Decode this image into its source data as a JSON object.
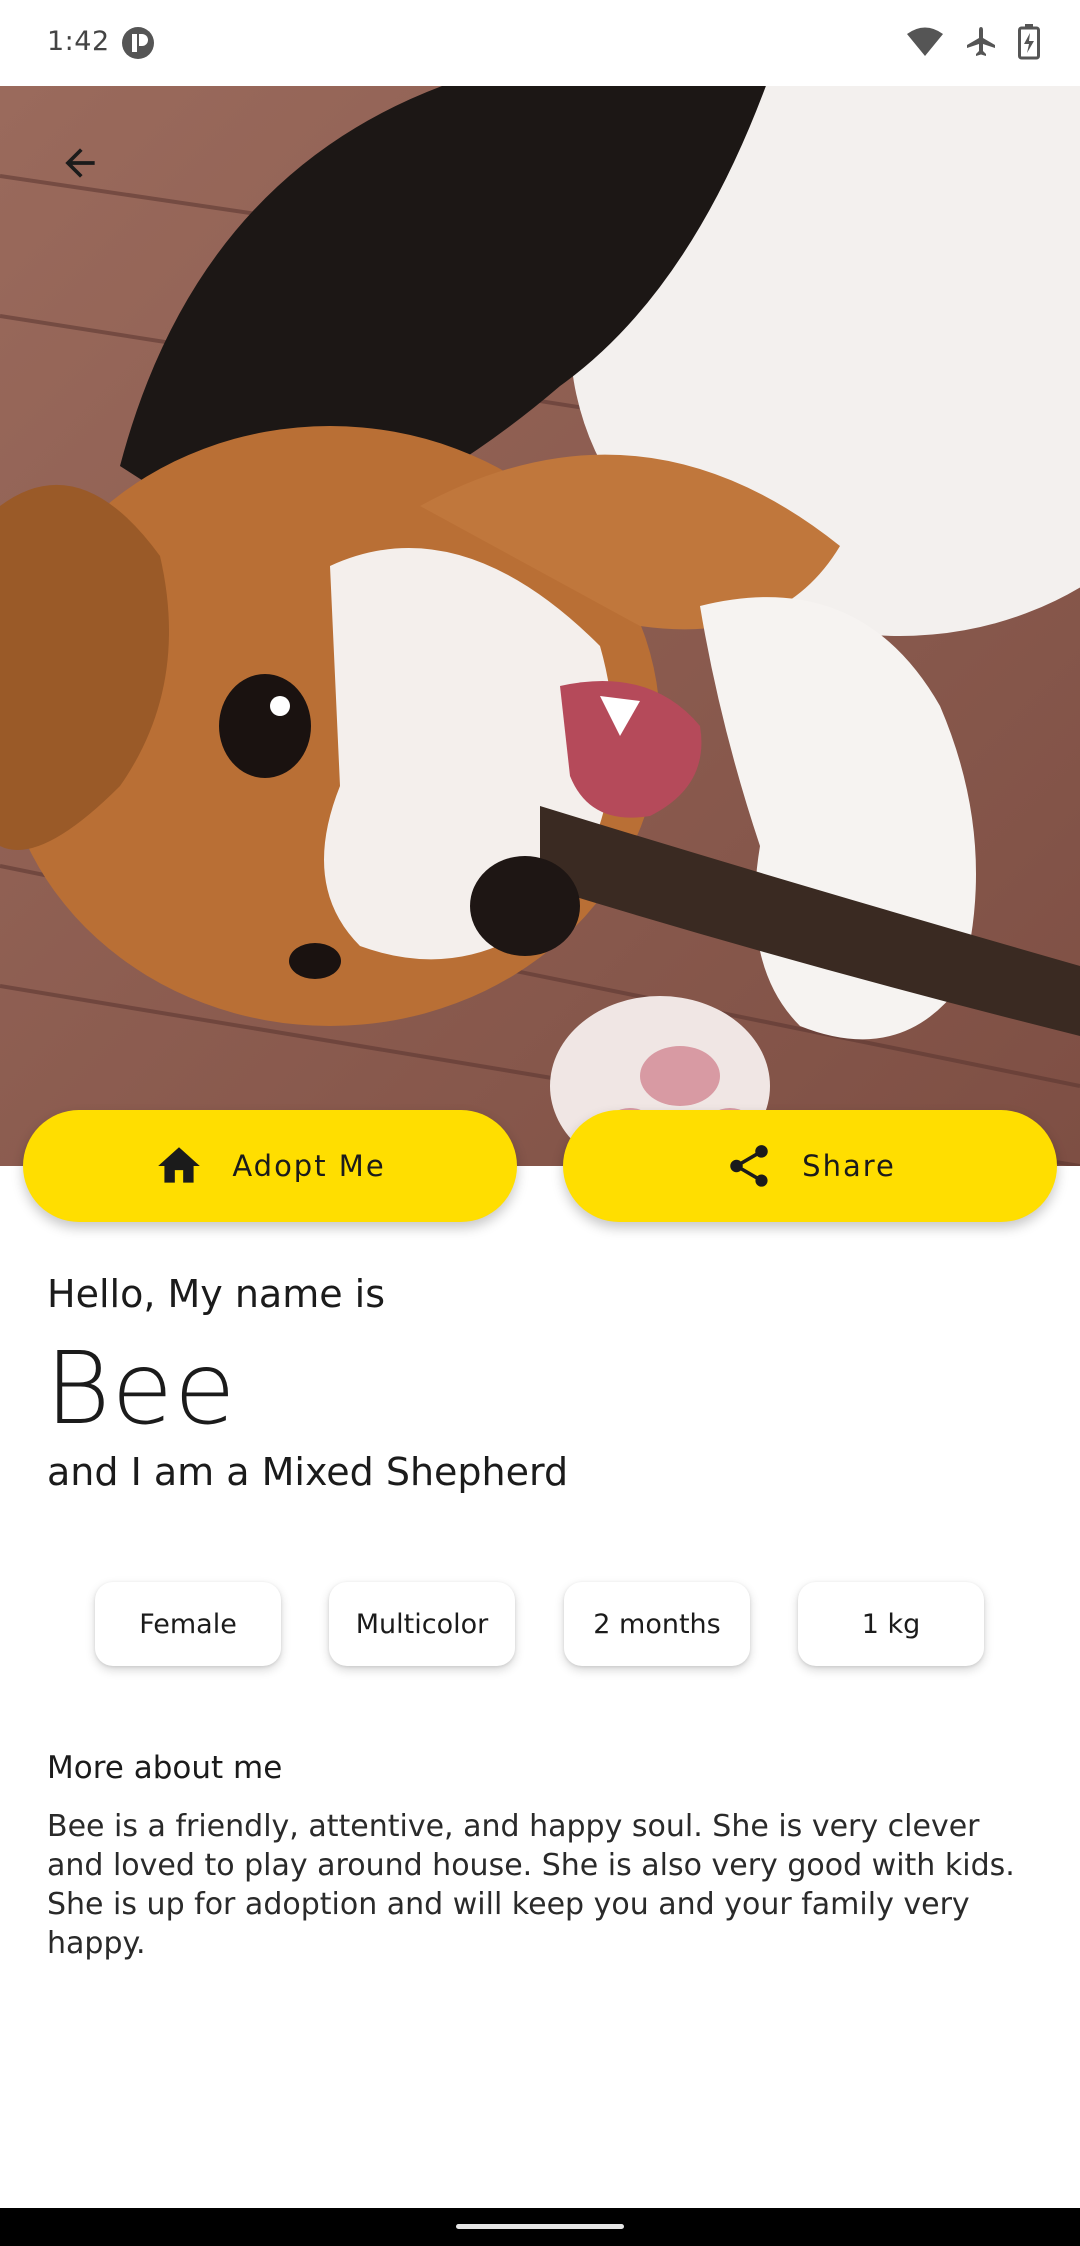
{
  "status_bar": {
    "time": "1:42",
    "icons": [
      "app-notification-icon",
      "wifi-icon",
      "airplane-icon",
      "battery-icon"
    ]
  },
  "hero": {
    "image": "beagle-puppy-photo",
    "back_icon": "arrow-back-icon"
  },
  "actions": {
    "adopt": {
      "label": "Adopt Me",
      "icon": "home-icon"
    },
    "share": {
      "label": "Share",
      "icon": "share-icon"
    },
    "button_color": "#FFDE00"
  },
  "profile": {
    "greeting": "Hello, My name is",
    "name": "Bee",
    "breed_line": "and I am a Mixed Shepherd"
  },
  "attributes": [
    "Female",
    "Multicolor",
    "2 months",
    "1 kg"
  ],
  "about": {
    "title": "More about me",
    "body": "Bee is a friendly, attentive, and happy soul. She is very clever and loved to play around house. She is also very good with kids. She is up for adoption and will keep you and your family very happy."
  }
}
